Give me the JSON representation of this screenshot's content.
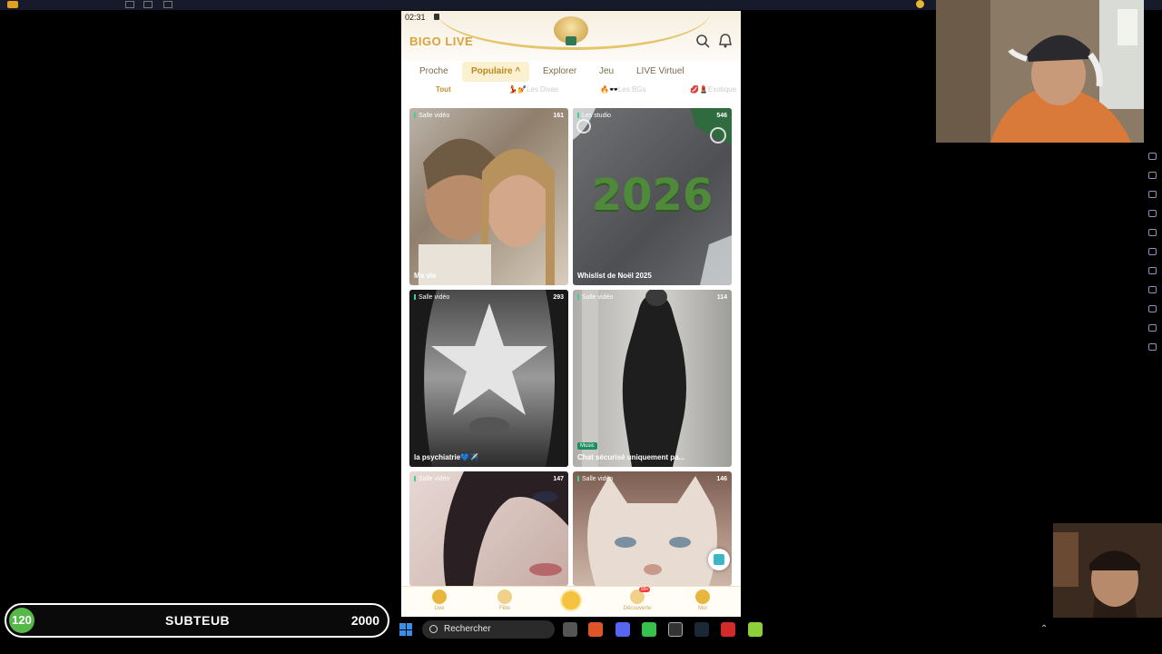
{
  "status_time": "02:31",
  "brand": "BIGO LIVE",
  "tabs": [
    {
      "label": "Proche"
    },
    {
      "label": "Populaire ^"
    },
    {
      "label": "Explorer"
    },
    {
      "label": "Jeu"
    },
    {
      "label": "LIVE Virtuel"
    }
  ],
  "subtabs": [
    {
      "label": "Tout"
    },
    {
      "label": "💃💅Les Divas"
    },
    {
      "label": "🔥🕶️Les BGs"
    },
    {
      "label": "💋💄Exotique"
    }
  ],
  "cards": [
    {
      "badge": "Salle vidéo",
      "viewers": "161",
      "title": "Ma vie",
      "music": ""
    },
    {
      "badge": "Les studio",
      "viewers": "546",
      "title": "Whislist de Noël 2025",
      "music": ""
    },
    {
      "badge": "Salle vidéo",
      "viewers": "293",
      "title": "la psychiatrie💙✈️",
      "music": ""
    },
    {
      "badge": "Salle vidéo",
      "viewers": "114",
      "title": "Chat sécurisé uniquement pa...",
      "music": "Music"
    },
    {
      "badge": "Salle vidéo",
      "viewers": "147",
      "title": "",
      "music": ""
    },
    {
      "badge": "Salle vidéo",
      "viewers": "146",
      "title": "",
      "music": ""
    }
  ],
  "card2_year": "2026",
  "bottom_nav": [
    {
      "label": "Live"
    },
    {
      "label": "Fête"
    },
    {
      "label": "Découverte"
    },
    {
      "label": "Moi"
    }
  ],
  "notification_badge": "99+",
  "subgoal": {
    "current": "120",
    "label": "SUBTEUB",
    "goal": "2000"
  },
  "taskbar": {
    "search_label": "Rechercher"
  },
  "colors": {
    "brand_gold": "#d6a43a",
    "active_tab_bg": "#fbf0cf",
    "subgoal_green": "#57b84a"
  }
}
